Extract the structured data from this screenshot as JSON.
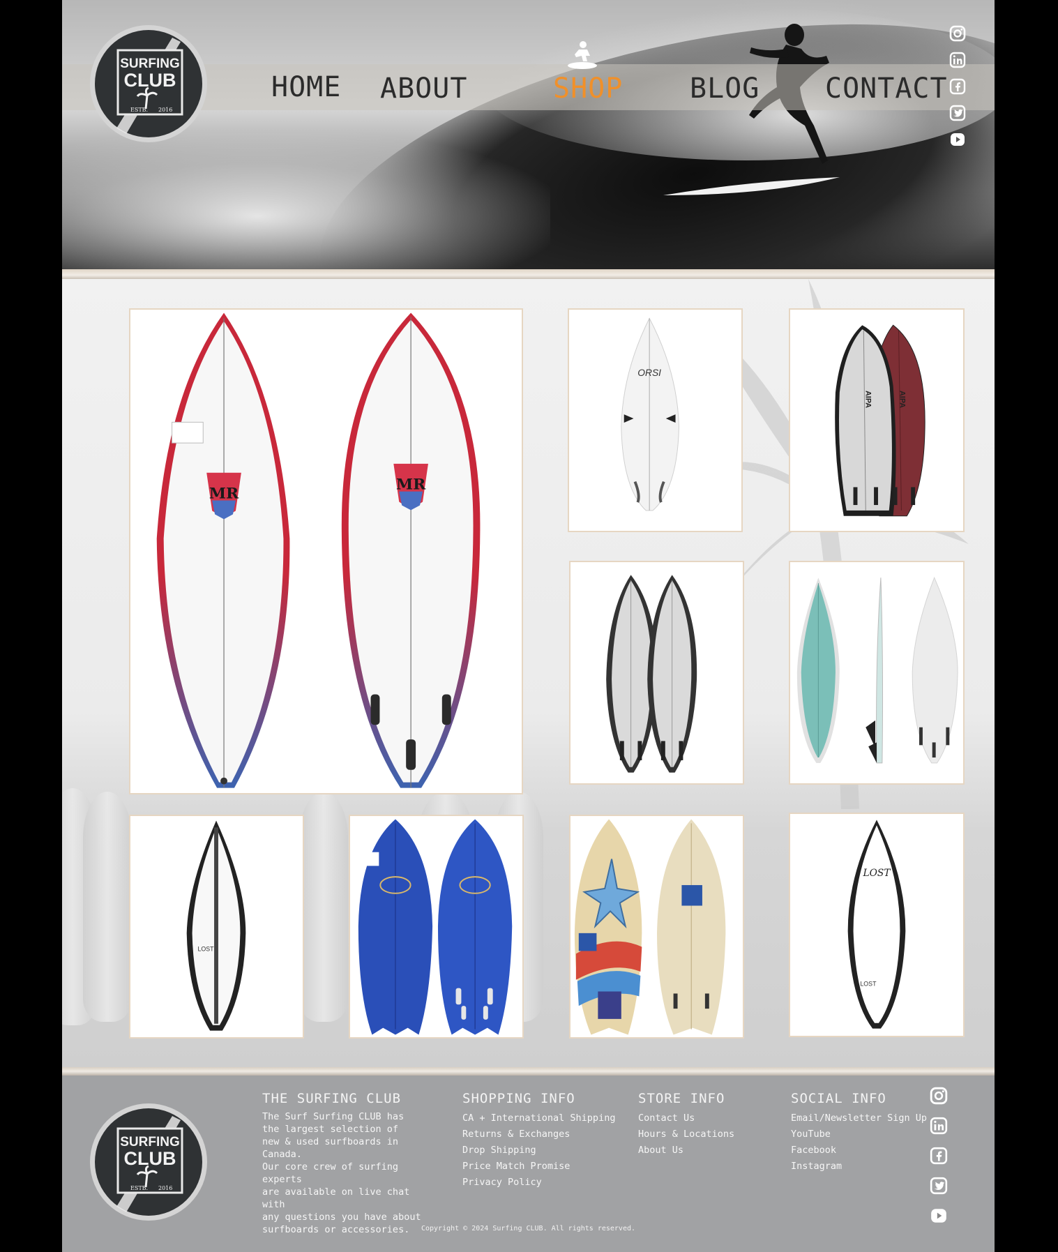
{
  "nav": {
    "items": [
      {
        "label": "HOME",
        "active": false
      },
      {
        "label": "ABOUT",
        "active": false
      },
      {
        "label": "SHOP",
        "active": true
      },
      {
        "label": "BLOG",
        "active": false
      },
      {
        "label": "CONTACT",
        "active": false
      }
    ],
    "active_color": "#f0902a"
  },
  "logo": {
    "line1": "SURFING",
    "line2": "CLUB",
    "estb": "ESTB.",
    "year": "2016"
  },
  "social_icons": [
    "instagram-icon",
    "linkedin-icon",
    "facebook-icon",
    "twitter-icon",
    "youtube-icon"
  ],
  "gallery": {
    "products": [
      {
        "name": "mr-twin-fin-board",
        "colors": [
          "#c8283a",
          "#3c63b0"
        ]
      },
      {
        "name": "white-shortboard",
        "colors": [
          "#f4f4f4"
        ]
      },
      {
        "name": "burgundy-twin-board",
        "colors": [
          "#7e2f35",
          "#d5d5d5"
        ]
      },
      {
        "name": "grey-twin-board",
        "colors": [
          "#d6d6d6",
          "#333333"
        ]
      },
      {
        "name": "teal-shortboard-with-fins",
        "colors": [
          "#7bbfb8",
          "#eeeeee"
        ]
      },
      {
        "name": "black-rail-shortboard",
        "colors": [
          "#222222",
          "#ffffff"
        ]
      },
      {
        "name": "blue-fish-board",
        "colors": [
          "#2a4fb8",
          "#1a2f80"
        ]
      },
      {
        "name": "vintage-star-fish-board",
        "colors": [
          "#e7d6aa",
          "#4b8fd1"
        ]
      },
      {
        "name": "lost-shortboard",
        "colors": [
          "#1f1f1f",
          "#ffffff"
        ]
      }
    ]
  },
  "footer": {
    "about": {
      "heading": "THE SURFING CLUB",
      "text": "The Surf Surfing CLUB has\nthe largest selection of\nnew & used surfboards in Canada.\nOur core crew of surfing experts\nare available on live chat with\nany questions you have about\nsurfboards or accessories."
    },
    "shopping": {
      "heading": "SHOPPING INFO",
      "links": [
        "CA + International Shipping",
        "Returns & Exchanges",
        "Drop Shipping",
        "Price Match Promise",
        "Privacy Policy"
      ]
    },
    "store": {
      "heading": "STORE INFO",
      "links": [
        "Contact Us",
        "Hours & Locations",
        "About Us"
      ]
    },
    "social": {
      "heading": "SOCIAL INFO",
      "links": [
        "Email/Newsletter Sign Up",
        "YouTube",
        "Facebook",
        "Instagram"
      ]
    },
    "copyright": "Copyright © 2024 Surfing CLUB. All rights reserved."
  }
}
